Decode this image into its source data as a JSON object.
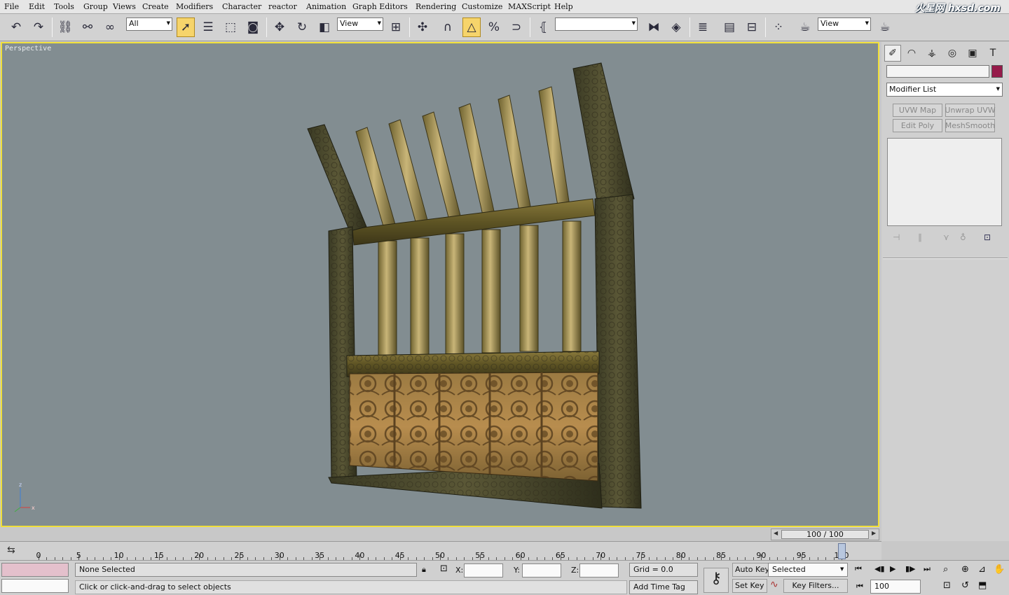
{
  "menu": [
    "File",
    "Edit",
    "Tools",
    "Group",
    "Views",
    "Create",
    "Modifiers",
    "Character",
    "reactor",
    "Animation",
    "Graph Editors",
    "Rendering",
    "Customize",
    "MAXScript",
    "Help"
  ],
  "logo": "火星网 hxsd.com",
  "toolbar": {
    "selection_filter": "All",
    "ref_coord_1": "View",
    "named_selection": "",
    "ref_coord_2": "View"
  },
  "viewport": {
    "label": "Perspective",
    "axis_x": "x",
    "axis_z": "z"
  },
  "command_panel": {
    "object_name": "",
    "object_color": "#961b4a",
    "modifier_list": "Modifier List",
    "modifier_buttons": [
      "UVW Map",
      "Unwrap UVW",
      "Edit Poly",
      "MeshSmooth"
    ]
  },
  "time_slider": {
    "label": "100 / 100",
    "current_frame": 100,
    "total_frames": 100
  },
  "timeline": {
    "ticks": [
      "0",
      "5",
      "10",
      "15",
      "20",
      "25",
      "30",
      "35",
      "40",
      "45",
      "50",
      "55",
      "60",
      "65",
      "70",
      "75",
      "80",
      "85",
      "90",
      "95",
      "100"
    ]
  },
  "status": {
    "selection": "None Selected",
    "prompt": "Click or click-and-drag to select objects",
    "x_label": "X:",
    "x_value": "",
    "y_label": "Y:",
    "y_value": "",
    "z_label": "Z:",
    "z_value": "",
    "grid": "Grid = 0.0",
    "add_time_tag": "Add Time Tag",
    "auto_key": "Auto Key",
    "set_key": "Set Key",
    "key_mode": "Selected",
    "key_filters": "Key Filters...",
    "current_frame": "100"
  },
  "colors": {
    "viewport_bg": "#828d91",
    "viewport_border": "#f0df3a",
    "active_tool": "#f6d46b"
  }
}
